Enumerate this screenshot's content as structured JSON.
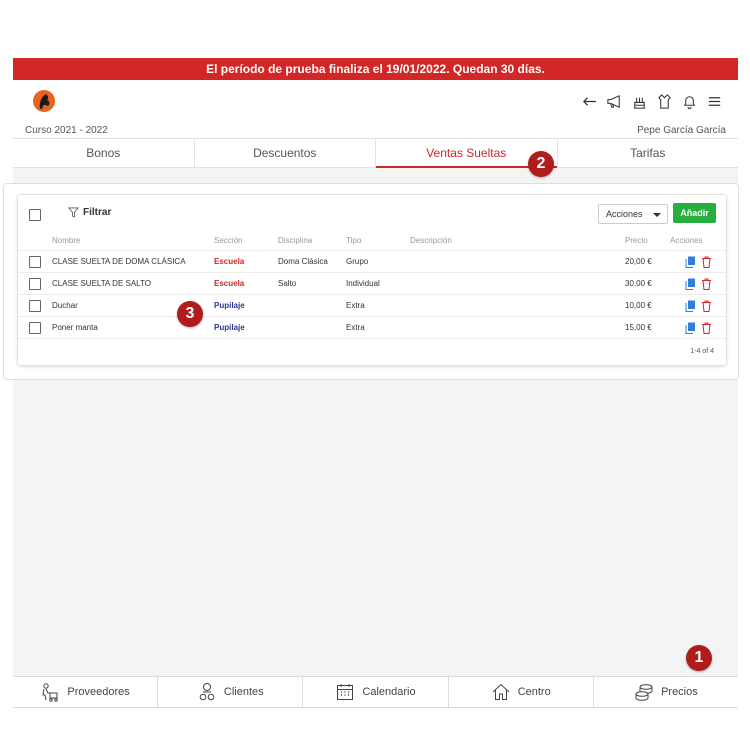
{
  "trial_banner": "El período de prueba finaliza el 19/01/2022. Quedan 30 días.",
  "header": {
    "course": "Curso 2021 - 2022",
    "user": "Pepe García García",
    "icons": [
      "arrow-left-icon",
      "megaphone-icon",
      "cake-icon",
      "shirt-icon",
      "bell-icon",
      "menu-icon"
    ]
  },
  "tabs": [
    {
      "label": "Bonos",
      "active": false
    },
    {
      "label": "Descuentos",
      "active": false
    },
    {
      "label": "Ventas Sueltas",
      "active": true
    },
    {
      "label": "Tarifas",
      "active": false
    }
  ],
  "markers": [
    "1",
    "2",
    "3"
  ],
  "toolbar": {
    "filter_label": "Filtrar",
    "actions_label": "Acciones",
    "add_label": "Añadir"
  },
  "table": {
    "headers": [
      "Nombre",
      "Sección",
      "Disciplina",
      "Tipo",
      "Descripción",
      "Precio",
      "Acciones"
    ],
    "rows": [
      {
        "nombre": "CLASE SUELTA DE DOMA CLÁSICA",
        "seccion": "Escuela",
        "disciplina": "Doma Clásica",
        "tipo": "Grupo",
        "descripcion": "",
        "precio": "20,00 €"
      },
      {
        "nombre": "CLASE SUELTA DE SALTO",
        "seccion": "Escuela",
        "disciplina": "Salto",
        "tipo": "Individual",
        "descripcion": "",
        "precio": "30,00 €"
      },
      {
        "nombre": "Duchar",
        "seccion": "Pupilaje",
        "disciplina": "",
        "tipo": "Extra",
        "descripcion": "",
        "precio": "10,00 €"
      },
      {
        "nombre": "Poner manta",
        "seccion": "Pupilaje",
        "disciplina": "",
        "tipo": "Extra",
        "descripcion": "",
        "precio": "15,00 €"
      }
    ],
    "pagination": "1-4 of 4"
  },
  "bottom_nav": [
    {
      "label": "Proveedores",
      "icon": "suppliers-icon"
    },
    {
      "label": "Clientes",
      "icon": "clients-icon"
    },
    {
      "label": "Calendario",
      "icon": "calendar-icon"
    },
    {
      "label": "Centro",
      "icon": "home-icon"
    },
    {
      "label": "Precios",
      "icon": "coins-icon"
    }
  ],
  "colors": {
    "brand_red": "#d32626",
    "marker_red": "#b01c1c",
    "add_green": "#27ae3f",
    "section_red": "#c62828",
    "section_blue": "#283593",
    "icon_blue": "#2f7ed8"
  }
}
